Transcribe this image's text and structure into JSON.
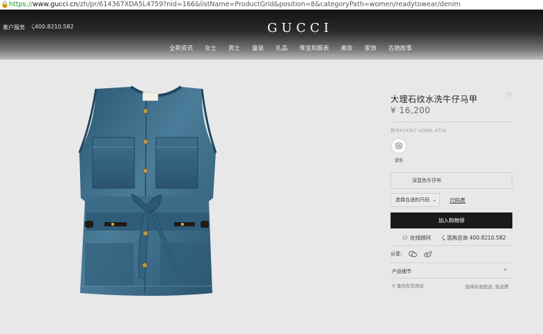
{
  "browser": {
    "lock": "🔒",
    "url_scheme": "https://",
    "url_host": "www.gucci.cn",
    "url_path": "/zh/pr/614367XDA5L4759?nid=166&listName=ProductGrid&position=8&categoryPath=women/readytowear/denim"
  },
  "header": {
    "service_label": "客户服务",
    "phone": "⤹400.8210.582",
    "logo": "GUCCI",
    "nav": [
      "全新资讯",
      "女士",
      "男士",
      "童装",
      "礼品",
      "珠宝和腕表",
      "美妆",
      "家饰",
      "古驰故事"
    ]
  },
  "product": {
    "title": "大理石纹水洗牛仔马甲",
    "price": "¥ 16,200",
    "sku": "款号614367 XDA5L 4759",
    "color_label": "蓝色",
    "material": "深蓝色牛仔布",
    "size_select": "选择合适的尺码",
    "size_guide": "尺码表",
    "add_to_bag": "加入购物袋",
    "online_consult": "在线顾问",
    "phone_consult": "选购咨询 400.8210.582",
    "share_label": "分享:",
    "details_label": "产品细节",
    "store_label": "查找有货商店",
    "shipping_label": "选择标准配送, 免运费"
  },
  "colors": {
    "denim": "#33607c",
    "bag_button": "#1a1a1a",
    "url_green": "#1b9b2f"
  },
  "icons": {
    "heart": "heart-icon",
    "chat": "chat-bubble-icon",
    "phone": "phone-icon",
    "wechat": "wechat-icon",
    "weibo": "weibo-icon",
    "location": "location-pin-icon",
    "chevron": "chevron-right-icon"
  }
}
